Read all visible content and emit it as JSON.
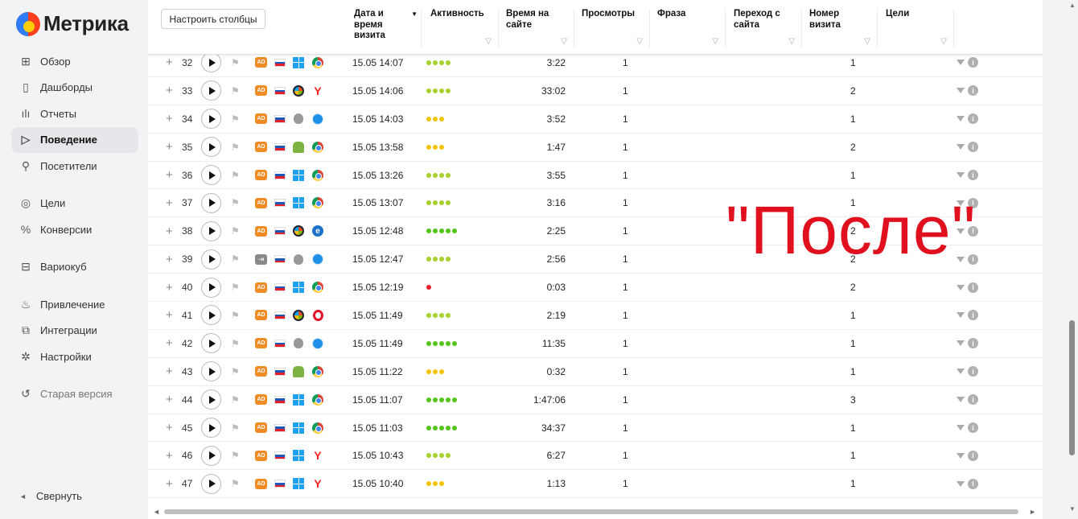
{
  "brand": {
    "name": "Метрика"
  },
  "sidebar": {
    "items": [
      {
        "label": "Обзор",
        "icon": "grid-icon",
        "glyph": "⊞",
        "active": false
      },
      {
        "label": "Дашборды",
        "icon": "dashboard-icon",
        "glyph": "▯",
        "active": false
      },
      {
        "label": "Отчеты",
        "icon": "bar-chart-icon",
        "glyph": "ılı",
        "active": false
      },
      {
        "label": "Поведение",
        "icon": "play-outline-icon",
        "glyph": "▷",
        "active": true
      },
      {
        "label": "Посетители",
        "icon": "person-icon",
        "glyph": "⚲",
        "active": false
      },
      {
        "label": "Цели",
        "icon": "target-icon",
        "glyph": "◎",
        "active": false
      },
      {
        "label": "Конверсии",
        "icon": "percent-icon",
        "glyph": "%",
        "active": false
      },
      {
        "label": "Вариокуб",
        "icon": "cube-icon",
        "glyph": "⊟",
        "active": false
      },
      {
        "label": "Привлечение",
        "icon": "flame-icon",
        "glyph": "♨",
        "active": false
      },
      {
        "label": "Интеграции",
        "icon": "puzzle-icon",
        "glyph": "⧉",
        "active": false
      },
      {
        "label": "Настройки",
        "icon": "gear-icon",
        "glyph": "✲",
        "active": false
      },
      {
        "label": "Старая версия",
        "icon": "undo-icon",
        "glyph": "↺",
        "active": false
      }
    ],
    "collapse_label": "Свернуть"
  },
  "toolbar": {
    "configure_columns_label": "Настроить столбцы"
  },
  "columns": {
    "datetime": "Дата и время визита",
    "activity": "Активность",
    "time_on_site": "Время на сайте",
    "pageviews": "Просмотры",
    "phrase": "Фраза",
    "referrer": "Переход с сайта",
    "visit_number": "Номер визита",
    "goals": "Цели"
  },
  "colors": {
    "dot_green": "#52c41a",
    "dot_lime": "#a6d02c",
    "dot_yellow": "#f5c400",
    "dot_red": "#e8202a",
    "accent_red": "#e0101f"
  },
  "rows": [
    {
      "n": "32",
      "source": "AD",
      "os": "windows",
      "browser": "chrome",
      "datetime": "15.05 14:07",
      "activity": 4,
      "time": "3:22",
      "views": "1",
      "visit_no": "1"
    },
    {
      "n": "33",
      "source": "AD",
      "os": "windows-xp",
      "browser": "yandex",
      "datetime": "15.05 14:06",
      "activity": 4,
      "time": "33:02",
      "views": "1",
      "visit_no": "2"
    },
    {
      "n": "34",
      "source": "AD",
      "os": "apple",
      "browser": "safari",
      "datetime": "15.05 14:03",
      "activity": 3,
      "time": "3:52",
      "views": "1",
      "visit_no": "1"
    },
    {
      "n": "35",
      "source": "AD",
      "os": "android",
      "browser": "chrome",
      "datetime": "15.05 13:58",
      "activity": 3,
      "time": "1:47",
      "views": "1",
      "visit_no": "2"
    },
    {
      "n": "36",
      "source": "AD",
      "os": "windows",
      "browser": "chrome",
      "datetime": "15.05 13:26",
      "activity": 4,
      "time": "3:55",
      "views": "1",
      "visit_no": "1"
    },
    {
      "n": "37",
      "source": "AD",
      "os": "windows",
      "browser": "chrome",
      "datetime": "15.05 13:07",
      "activity": 4,
      "time": "3:16",
      "views": "1",
      "visit_no": "1"
    },
    {
      "n": "38",
      "source": "AD",
      "os": "windows-xp",
      "browser": "edge",
      "datetime": "15.05 12:48",
      "activity": 5,
      "time": "2:25",
      "views": "1",
      "visit_no": "2"
    },
    {
      "n": "39",
      "source": "internal",
      "os": "apple",
      "browser": "safari",
      "datetime": "15.05 12:47",
      "activity": 4,
      "time": "2:56",
      "views": "1",
      "visit_no": "2"
    },
    {
      "n": "40",
      "source": "AD",
      "os": "windows",
      "browser": "chrome",
      "datetime": "15.05 12:19",
      "activity": 1,
      "time": "0:03",
      "views": "1",
      "visit_no": "2"
    },
    {
      "n": "41",
      "source": "AD",
      "os": "windows-xp",
      "browser": "opera",
      "datetime": "15.05 11:49",
      "activity": 4,
      "time": "2:19",
      "views": "1",
      "visit_no": "1"
    },
    {
      "n": "42",
      "source": "AD",
      "os": "apple",
      "browser": "safari",
      "datetime": "15.05 11:49",
      "activity": 5,
      "time": "11:35",
      "views": "1",
      "visit_no": "1"
    },
    {
      "n": "43",
      "source": "AD",
      "os": "android",
      "browser": "chrome",
      "datetime": "15.05 11:22",
      "activity": 3,
      "time": "0:32",
      "views": "1",
      "visit_no": "1"
    },
    {
      "n": "44",
      "source": "AD",
      "os": "windows",
      "browser": "chrome",
      "datetime": "15.05 11:07",
      "activity": 5,
      "time": "1:47:06",
      "views": "1",
      "visit_no": "3"
    },
    {
      "n": "45",
      "source": "AD",
      "os": "windows",
      "browser": "chrome",
      "datetime": "15.05 11:03",
      "activity": 5,
      "time": "34:37",
      "views": "1",
      "visit_no": "1"
    },
    {
      "n": "46",
      "source": "AD",
      "os": "windows",
      "browser": "yandex",
      "datetime": "15.05 10:43",
      "activity": 4,
      "time": "6:27",
      "views": "1",
      "visit_no": "1"
    },
    {
      "n": "47",
      "source": "AD",
      "os": "windows",
      "browser": "yandex",
      "datetime": "15.05 10:40",
      "activity": 3,
      "time": "1:13",
      "views": "1",
      "visit_no": "1"
    }
  ],
  "overlay": {
    "text": "\"После\""
  }
}
